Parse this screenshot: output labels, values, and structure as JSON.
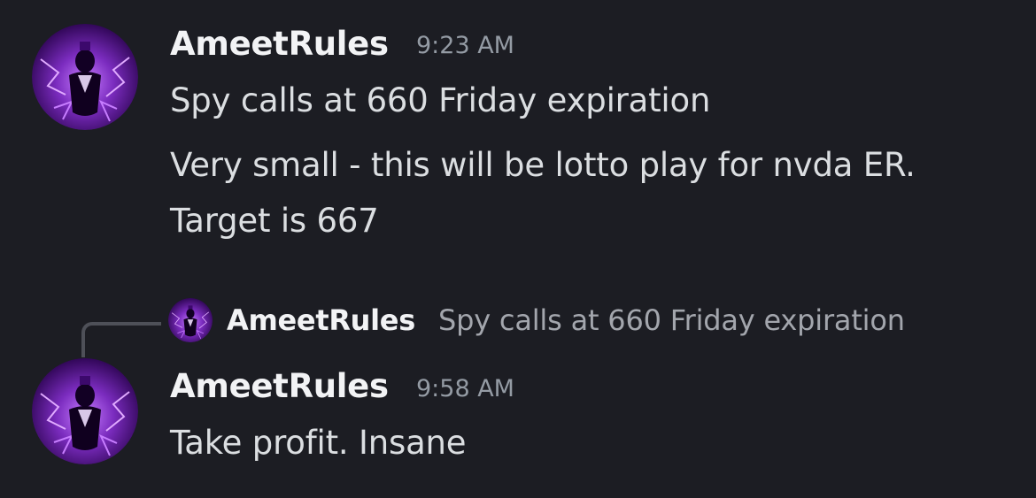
{
  "messages": [
    {
      "avatar_icon": "user-avatar",
      "username": "AmeetRules",
      "timestamp": "9:23 AM",
      "lines": [
        "Spy calls at 660 Friday expiration",
        "Very small - this will be lotto play for nvda ER.",
        "Target is 667"
      ]
    },
    {
      "reply": {
        "avatar_icon": "user-avatar",
        "username": "AmeetRules",
        "text": "Spy calls at 660 Friday expiration"
      },
      "avatar_icon": "user-avatar",
      "username": "AmeetRules",
      "timestamp": "9:58 AM",
      "lines": [
        "Take profit. Insane"
      ]
    }
  ],
  "colors": {
    "background": "#1c1d23",
    "username": "#f2f3f5",
    "text": "#dbdee1",
    "timestamp": "#949ba4",
    "avatar_accent": "#8a2be2"
  }
}
